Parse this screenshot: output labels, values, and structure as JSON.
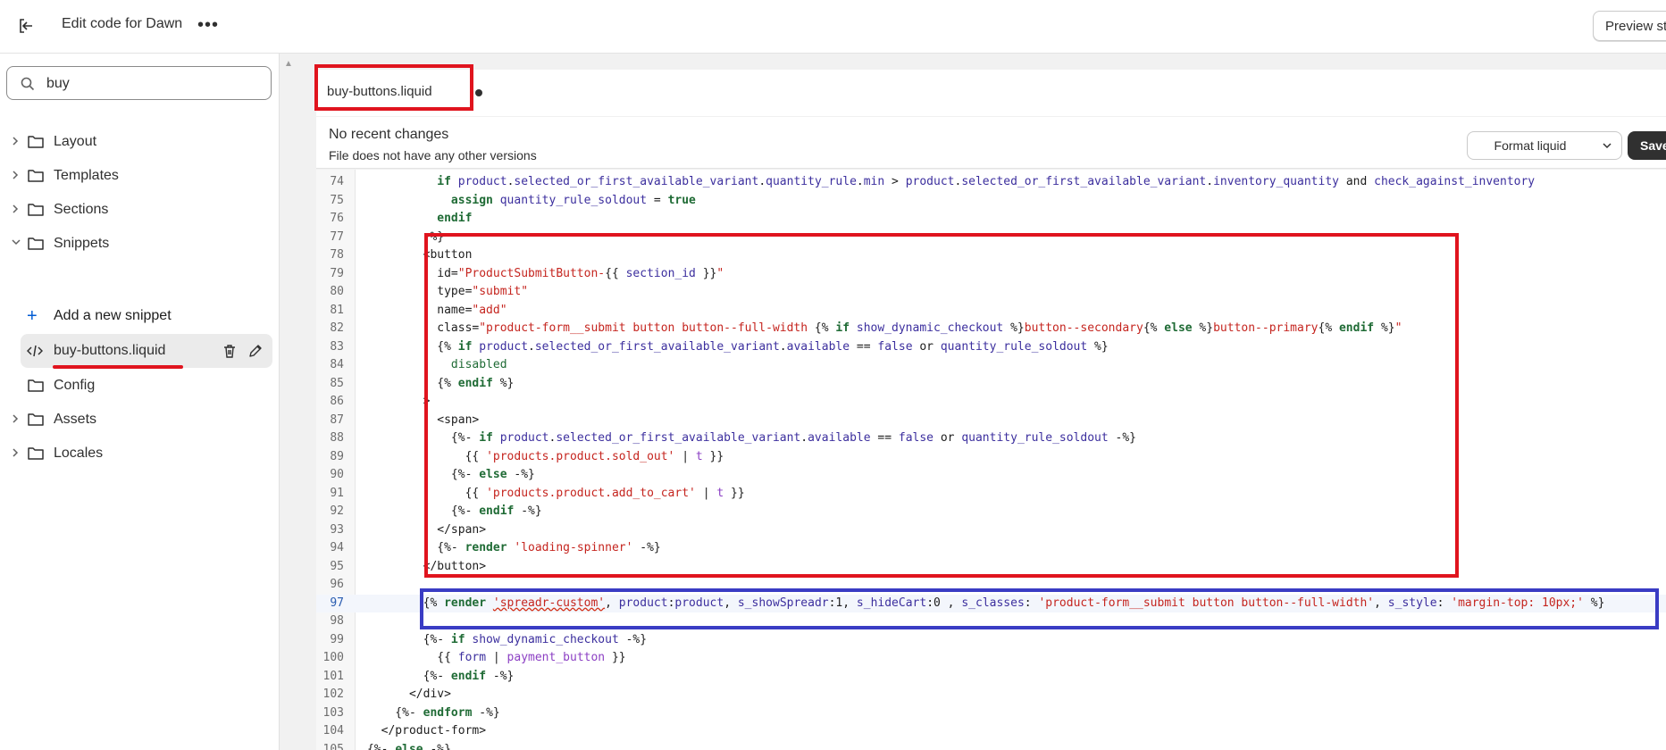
{
  "topbar": {
    "title": "Edit code for Dawn",
    "more": "•••",
    "preview": "Preview st"
  },
  "sidebar": {
    "search_value": "buy",
    "folders": [
      "Layout",
      "Templates",
      "Sections",
      "Snippets",
      "Config",
      "Assets",
      "Locales"
    ],
    "add_snippet": "Add a new snippet",
    "active_file": "buy-buttons.liquid"
  },
  "tab": {
    "label": "buy-buttons.liquid"
  },
  "header": {
    "title": "No recent changes",
    "subtitle": "File does not have any other versions",
    "format_label": "Format liquid",
    "save_label": "Save"
  },
  "code_lines": [
    {
      "n": "74"
    },
    {
      "n": "75"
    },
    {
      "n": "76"
    },
    {
      "n": "77"
    },
    {
      "n": "78"
    },
    {
      "n": "79"
    },
    {
      "n": "80"
    },
    {
      "n": "81"
    },
    {
      "n": "82"
    },
    {
      "n": "83"
    },
    {
      "n": "84"
    },
    {
      "n": "85"
    },
    {
      "n": "86"
    },
    {
      "n": "87"
    },
    {
      "n": "88"
    },
    {
      "n": "89"
    },
    {
      "n": "90"
    },
    {
      "n": "91"
    },
    {
      "n": "92"
    },
    {
      "n": "93"
    },
    {
      "n": "94"
    },
    {
      "n": "95"
    },
    {
      "n": "96"
    },
    {
      "n": "97"
    },
    {
      "n": "98"
    },
    {
      "n": "99"
    },
    {
      "n": "100"
    },
    {
      "n": "101"
    },
    {
      "n": "102"
    },
    {
      "n": "103"
    },
    {
      "n": "104"
    },
    {
      "n": "105"
    }
  ]
}
